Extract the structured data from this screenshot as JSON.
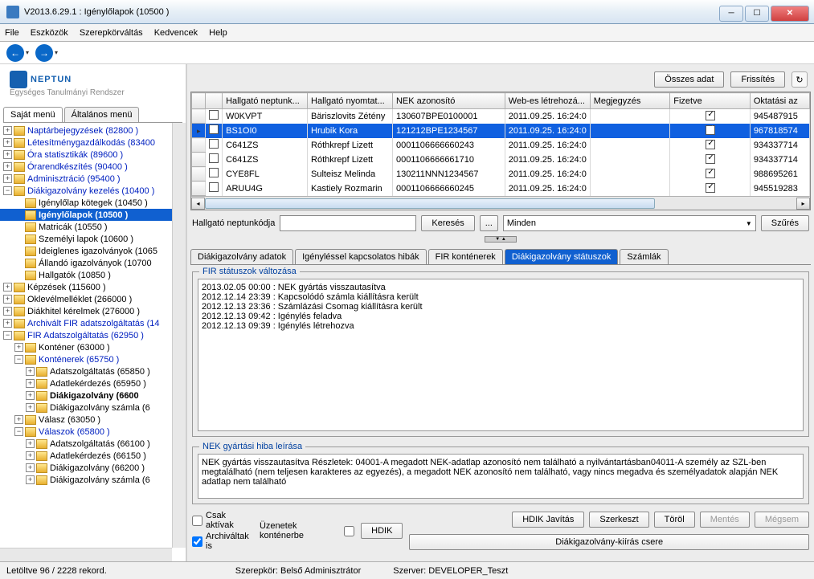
{
  "window": {
    "title": "V2013.6.29.1 : Igénylőlapok (10500  )"
  },
  "menu": {
    "file": "File",
    "tools": "Eszközök",
    "role": "Szerepkörváltás",
    "fav": "Kedvencek",
    "help": "Help"
  },
  "logo": {
    "text": "NEPTUN",
    "sub": "Egységes Tanulmányi Rendszer"
  },
  "left_tabs": {
    "own": "Saját menü",
    "general": "Általános menü"
  },
  "tree": {
    "i0": "Naptárbejegyzések (82800  )",
    "i1": "Létesítménygazdálkodás (83400",
    "i2": "Óra statisztikák (89600  )",
    "i3": "Órarendkészítés (90400  )",
    "i4": "Adminisztráció (95400  )",
    "i5": "Diákigazolvány kezelés (10400  )",
    "i6": "Igénylőlap kötegek (10450  )",
    "i7": "Igénylőlapok  (10500   )",
    "i8": "Matricák (10550  )",
    "i9": "Személyi lapok (10600  )",
    "i10": "Ideiglenes igazolványok (1065",
    "i11": "Állandó igazolványok (10700",
    "i12": "Hallgatók (10850  )",
    "i13": "Képzések (115600  )",
    "i14": "Oklevélmelléklet (266000  )",
    "i15": "Diákhitel kérelmek (276000  )",
    "i16": "Archivált FIR adatszolgáltatás (14",
    "i17": "FIR Adatszolgáltatás (62950  )",
    "i18": "Konténer (63000  )",
    "i19": "Konténerek (65750  )",
    "i20": "Adatszolgáltatás (65850  )",
    "i21": "Adatlekérdezés (65950  )",
    "i22": "Diákigazolvány (6600",
    "i23": "Diákigazolvány számla (6",
    "i24": "Válasz (63050  )",
    "i25": "Válaszok (65800  )",
    "i26": "Adatszolgáltatás (66100  )",
    "i27": "Adatlekérdezés (66150  )",
    "i28": "Diákigazolvány (66200  )",
    "i29": "Diákigazolvány számla (6"
  },
  "top_buttons": {
    "all": "Összes adat",
    "refresh": "Frissítés"
  },
  "grid": {
    "headers": {
      "c0": "",
      "c1": "",
      "c2": "Hallgató neptunk...",
      "c3": "Hallgató nyomtat...",
      "c4": "NEK azonosító",
      "c5": "Web-es létrehozá...",
      "c6": "Megjegyzés",
      "c7": "Fizetve",
      "c8": "Oktatási az"
    },
    "rows": [
      {
        "code": "W0KVPT",
        "name": "Bäriszlovits Zétény",
        "nek": "130607BPE0100001",
        "date": "2011.09.25. 16:24:0",
        "note": "",
        "paid": true,
        "edu": "945487915"
      },
      {
        "code": "BS1OI0",
        "name": "Hrubik Kora",
        "nek": "121212BPE1234567",
        "date": "2011.09.25. 16:24:0",
        "note": "",
        "paid": true,
        "edu": "967818574",
        "sel": true
      },
      {
        "code": "C641ZS",
        "name": "Róthkrepf Lizett",
        "nek": "0001106666660243",
        "date": "2011.09.25. 16:24:0",
        "note": "",
        "paid": true,
        "edu": "934337714"
      },
      {
        "code": "C641ZS",
        "name": "Róthkrepf Lizett",
        "nek": "0001106666661710",
        "date": "2011.09.25. 16:24:0",
        "note": "",
        "paid": true,
        "edu": "934337714"
      },
      {
        "code": "CYE8FL",
        "name": "Sulteisz Melinda",
        "nek": "130211NNN1234567",
        "date": "2011.09.25. 16:24:0",
        "note": "",
        "paid": true,
        "edu": "988695261"
      },
      {
        "code": "ARUU4G",
        "name": "Kastiely Rozmarin",
        "nek": "0001106666660245",
        "date": "2011.09.25. 16:24:0",
        "note": "",
        "paid": true,
        "edu": "945519283"
      }
    ]
  },
  "search": {
    "label": "Hallgató neptunkódja",
    "btn": "Keresés",
    "dots": "...",
    "combo": "Minden",
    "filter": "Szűrés"
  },
  "subtabs": {
    "t0": "Diákigazolvány adatok",
    "t1": "Igényléssel kapcsolatos hibák",
    "t2": "FIR konténerek",
    "t3": "Diákigazolvány státuszok",
    "t4": "Számlák"
  },
  "status_group": {
    "title": "FIR státuszok  változása",
    "text": "2013.02.05 00:00 : NEK gyártás visszautasítva\n2012.12.14 23:39 : Kapcsolódó számla kiállításra került\n2012.12.13 23:36 : Számlázási Csomag kiállításra került\n2012.12.13 09:42 : Igénylés feladva\n2012.12.13 09:39 : Igénylés létrehozva"
  },
  "error_group": {
    "title": "NEK gyártási hiba leírása",
    "text": "NEK gyártás visszautasítva Részletek: 04001-A megadott NEK-adatlap azonosító nem található a nyilvántartásban04011-A személy az SZL-ben megtalálható (nem teljesen karakteres az egyezés), a megadott NEK azonosító nem található, vagy nincs megadva és személyadatok alapján NEK adatlap nem található"
  },
  "bottom": {
    "only_active": "Csak aktívak",
    "archived": "Archiváltak is",
    "msg_cont": "Üzenetek konténerbe",
    "hdik": "HDIK",
    "hdik_fix": "HDIK Javítás",
    "edit": "Szerkeszt",
    "delete": "Töröl",
    "save": "Mentés",
    "cancel": "Mégsem",
    "swap": "Diákigazolvány-kiírás csere"
  },
  "status": {
    "left": "Letöltve 96 / 2228 rekord.",
    "role": "Szerepkör: Belső Adminisztrátor",
    "server": "Szerver: DEVELOPER_Teszt"
  }
}
